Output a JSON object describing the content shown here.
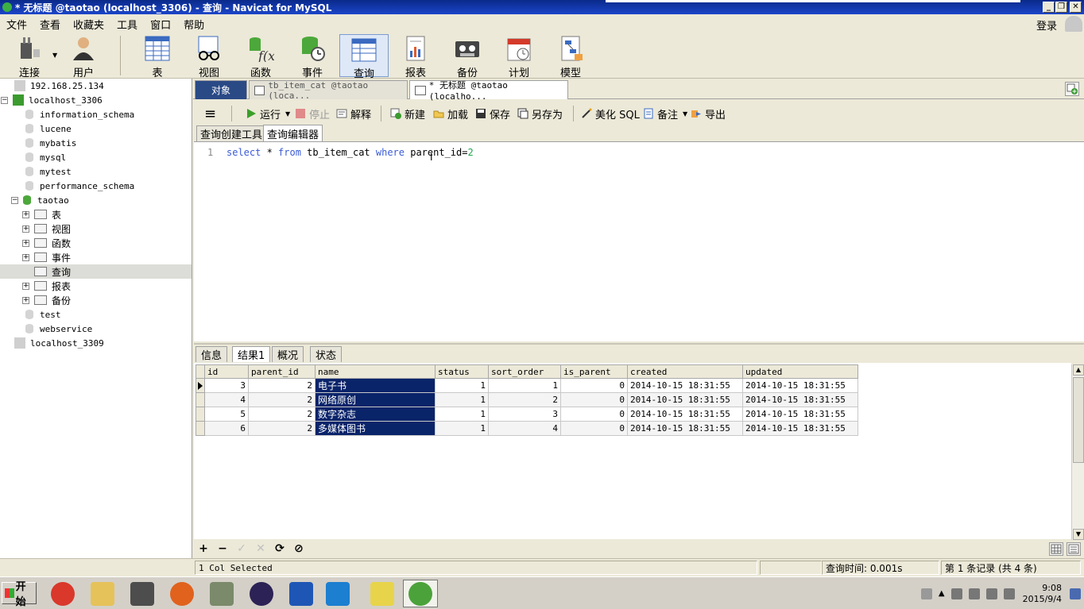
{
  "window": {
    "title": "* 无标题 @taotao (localhost_3306) - 查询 - Navicat for MySQL",
    "minimize": "_",
    "restore": "❐",
    "close": "✕"
  },
  "menu": {
    "items": [
      "文件",
      "查看",
      "收藏夹",
      "工具",
      "窗口",
      "帮助"
    ],
    "login": "登录"
  },
  "toolbar": {
    "buttons": [
      {
        "label": "连接",
        "icon": "plug-icon"
      },
      {
        "label": "用户",
        "icon": "user-icon"
      },
      {
        "label": "表",
        "icon": "table-icon"
      },
      {
        "label": "视图",
        "icon": "glasses-icon"
      },
      {
        "label": "函数",
        "icon": "function-icon"
      },
      {
        "label": "事件",
        "icon": "event-clock-icon"
      },
      {
        "label": "查询",
        "icon": "query-icon",
        "active": true
      },
      {
        "label": "报表",
        "icon": "report-icon"
      },
      {
        "label": "备份",
        "icon": "backup-tape-icon"
      },
      {
        "label": "计划",
        "icon": "calendar-icon"
      },
      {
        "label": "模型",
        "icon": "model-icon"
      }
    ]
  },
  "tree": {
    "nodes": [
      {
        "label": "192.168.25.134",
        "kind": "host"
      },
      {
        "label": "localhost_3306",
        "kind": "host-open",
        "expander": "−"
      },
      {
        "label": "information_schema",
        "kind": "db"
      },
      {
        "label": "lucene",
        "kind": "db"
      },
      {
        "label": "mybatis",
        "kind": "db"
      },
      {
        "label": "mysql",
        "kind": "db"
      },
      {
        "label": "mytest",
        "kind": "db"
      },
      {
        "label": "performance_schema",
        "kind": "db"
      },
      {
        "label": "taotao",
        "kind": "db-open",
        "expander": "−"
      },
      {
        "label": "表",
        "kind": "obj",
        "expander": "+"
      },
      {
        "label": "视图",
        "kind": "obj",
        "expander": "+"
      },
      {
        "label": "函数",
        "kind": "obj",
        "expander": "+"
      },
      {
        "label": "事件",
        "kind": "obj",
        "expander": "+"
      },
      {
        "label": "查询",
        "kind": "obj-selected"
      },
      {
        "label": "报表",
        "kind": "obj",
        "expander": "+"
      },
      {
        "label": "备份",
        "kind": "obj",
        "expander": "+"
      },
      {
        "label": "test",
        "kind": "db"
      },
      {
        "label": "webservice",
        "kind": "db"
      },
      {
        "label": "localhost_3309",
        "kind": "host"
      }
    ]
  },
  "tabs": {
    "object": "对象",
    "items": [
      {
        "label": "tb_item_cat @taotao (loca..."
      },
      {
        "label": "* 无标题 @taotao (localho..."
      }
    ]
  },
  "query_toolbar": {
    "menu": "≡",
    "run": "运行",
    "stop": "停止",
    "explain": "解释",
    "new": "新建",
    "load": "加载",
    "save": "保存",
    "save_as": "另存为",
    "beautify": "美化 SQL",
    "comment": "备注",
    "export": "导出"
  },
  "subtabs": {
    "builder": "查询创建工具",
    "editor": "查询编辑器"
  },
  "editor": {
    "line_number": "1",
    "tokens": [
      {
        "text": "select",
        "type": "kw"
      },
      {
        "text": " * ",
        "type": "plain"
      },
      {
        "text": "from",
        "type": "kw"
      },
      {
        "text": " tb_item_cat ",
        "type": "plain"
      },
      {
        "text": "where",
        "type": "kw"
      },
      {
        "text": " parent_id=",
        "type": "plain"
      },
      {
        "text": "2",
        "type": "num"
      }
    ]
  },
  "result_tabs": [
    "信息",
    "结果1",
    "概况",
    "状态"
  ],
  "results": {
    "columns": [
      "id",
      "parent_id",
      "name",
      "status",
      "sort_order",
      "is_parent",
      "created",
      "updated"
    ],
    "rows": [
      [
        "3",
        "2",
        "电子书",
        "1",
        "1",
        "0",
        "2014-10-15 18:31:55",
        "2014-10-15 18:31:55"
      ],
      [
        "4",
        "2",
        "网络原创",
        "1",
        "2",
        "0",
        "2014-10-15 18:31:55",
        "2014-10-15 18:31:55"
      ],
      [
        "5",
        "2",
        "数字杂志",
        "1",
        "3",
        "0",
        "2014-10-15 18:31:55",
        "2014-10-15 18:31:55"
      ],
      [
        "6",
        "2",
        "多媒体图书",
        "1",
        "4",
        "0",
        "2014-10-15 18:31:55",
        "2014-10-15 18:31:55"
      ]
    ]
  },
  "grid_nav": {
    "add": "+",
    "delete": "−",
    "apply": "✓",
    "cancel": "✕",
    "refresh": "⟳",
    "stop": "⊘"
  },
  "statusbar": {
    "selection": "1 Col Selected",
    "query_time": "查询时间: 0.001s",
    "record": "第 1 条记录 (共 4 条)"
  },
  "taskbar": {
    "start": "开始",
    "apps": [
      {
        "name": "chrome-icon",
        "color": "#d9382b"
      },
      {
        "name": "file-explorer-icon",
        "color": "#e6c25a"
      },
      {
        "name": "sublime-text-icon",
        "color": "#4d4d4d"
      },
      {
        "name": "firefox-icon",
        "color": "#e0621d"
      },
      {
        "name": "config-tool-icon",
        "color": "#7a8a6a"
      },
      {
        "name": "eclipse-icon",
        "color": "#2c2255"
      },
      {
        "name": "word-icon",
        "color": "#1e56b5"
      },
      {
        "name": "virtualbox-icon",
        "color": "#1c7fd0"
      },
      {
        "name": "help-icon",
        "color": "#e8d44a"
      },
      {
        "name": "navicat-icon",
        "color": "#4ba23a",
        "active": true
      }
    ],
    "clock_time": "9:08",
    "clock_date": "2015/9/4"
  }
}
